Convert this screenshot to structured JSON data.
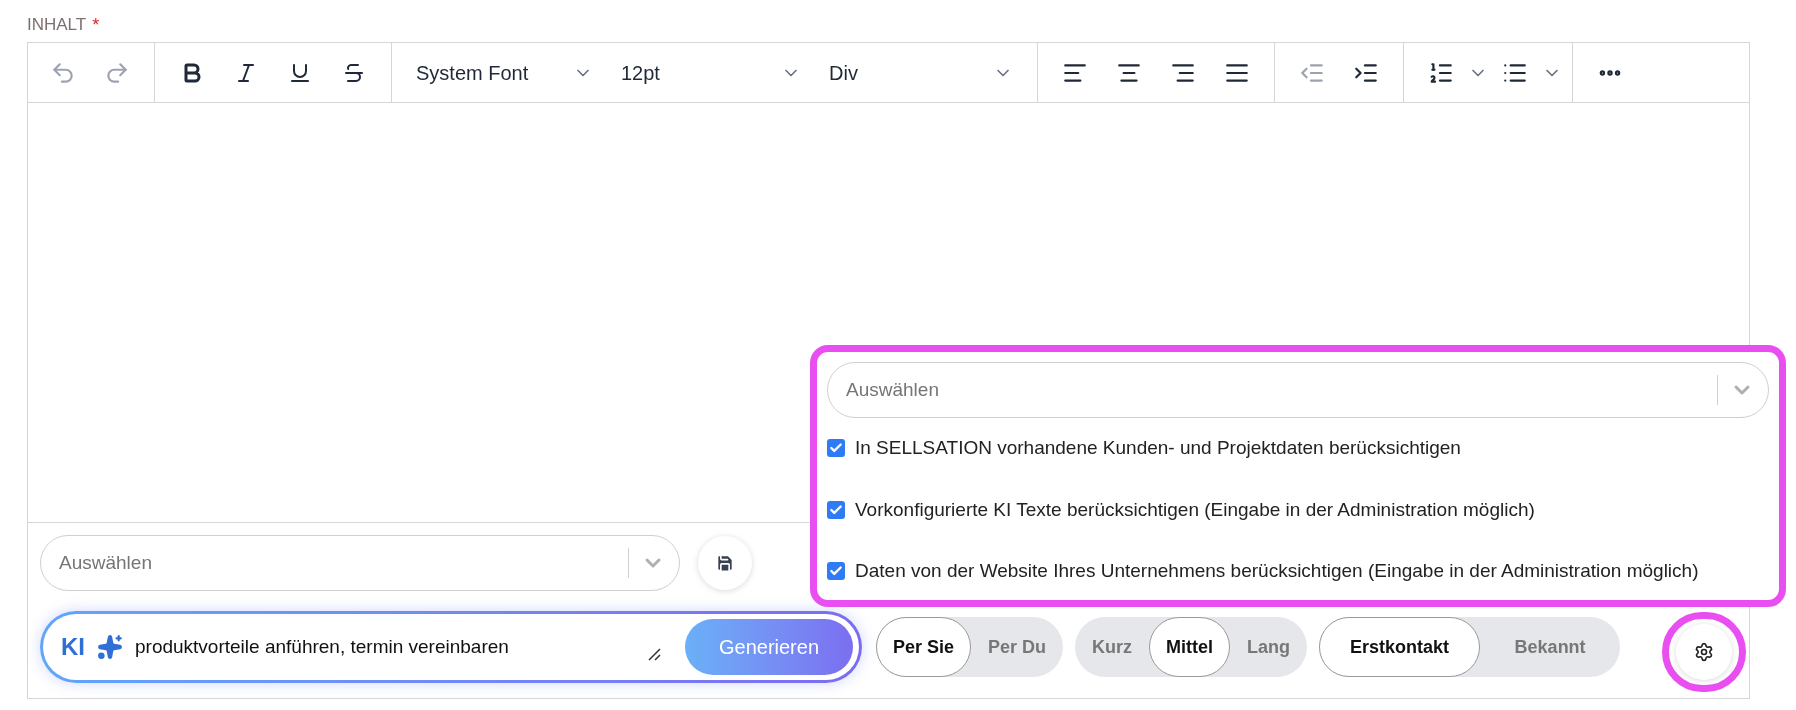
{
  "field_label": {
    "text": "INHALT",
    "required_mark": "*"
  },
  "toolbar": {
    "undo": {
      "disabled": true
    },
    "redo": {
      "disabled": true
    },
    "font": "System Font",
    "size": "12pt",
    "block": "Div",
    "outdent": {
      "disabled": true
    },
    "indent": {
      "disabled": false
    }
  },
  "template_select": {
    "placeholder": "Auswählen"
  },
  "prompt": {
    "badge": "KI",
    "value": "produktvorteile anführen, termin vereinbaren",
    "button": "Generieren"
  },
  "segment_groups": [
    {
      "options": [
        {
          "label": "Per Sie",
          "selected": true
        },
        {
          "label": "Per Du",
          "selected": false
        }
      ]
    },
    {
      "options": [
        {
          "label": "Kurz",
          "selected": false
        },
        {
          "label": "Mittel",
          "selected": true
        },
        {
          "label": "Lang",
          "selected": false
        }
      ]
    },
    {
      "options": [
        {
          "label": "Erstkontakt",
          "selected": true
        },
        {
          "label": "Bekannt",
          "selected": false
        }
      ]
    }
  ],
  "popover": {
    "select": {
      "placeholder": "Auswählen"
    },
    "options": [
      {
        "label": "In SELLSATION vorhandene Kunden- und Projektdaten berücksichtigen",
        "checked": true
      },
      {
        "label": "Vorkonfigurierte KI Texte berücksichtigen (Eingabe in der Administration möglich)",
        "checked": true
      },
      {
        "label": "Daten von der Website Ihres Unternehmens berücksichtigen (Eingabe in der Administration möglich)",
        "checked": true
      }
    ]
  }
}
